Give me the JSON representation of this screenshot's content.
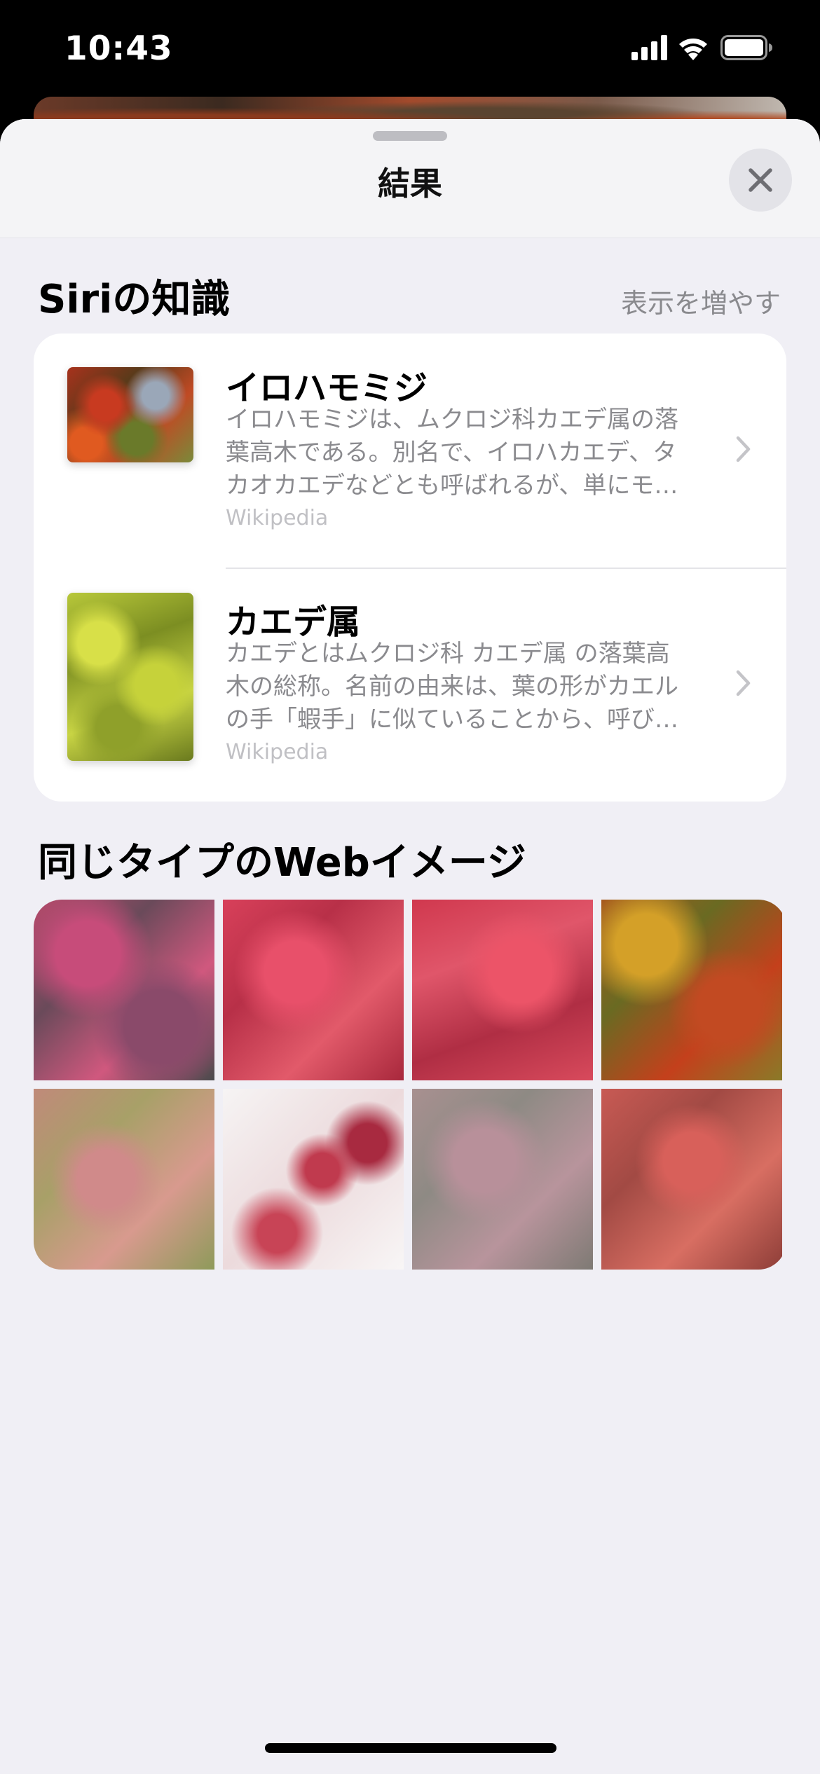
{
  "status_bar": {
    "time": "10:43",
    "icons": [
      "cellular-signal-icon",
      "wifi-icon",
      "battery-icon"
    ]
  },
  "sheet": {
    "title": "結果",
    "close_icon": "close-icon"
  },
  "siri_knowledge": {
    "title": "Siriの知識",
    "show_more_label": "表示を増やす",
    "items": [
      {
        "title": "イロハモミジ",
        "description_lines": [
          "イロハモミジは、ムクロジ科カエデ属の落",
          "葉高木である。別名で、イロハカエデ、タ",
          "カオカエデなどとも呼ばれるが、単にモ…"
        ],
        "source": "Wikipedia"
      },
      {
        "title": "カエデ属",
        "description_lines": [
          "カエデとはムクロジ科 カエデ属 の落葉高",
          "木の総称。名前の由来は、葉の形がカエル",
          "の手「蝦手」に似ていることから、呼び…"
        ],
        "source": "Wikipedia"
      }
    ]
  },
  "web_images": {
    "title": "同じタイプのWebイメージ",
    "count": 8
  },
  "colors": {
    "sheet_background": "#f0eff5",
    "card_background": "#ffffff",
    "secondary_text": "#8a8a8e",
    "source_text": "#c0c0c4"
  }
}
